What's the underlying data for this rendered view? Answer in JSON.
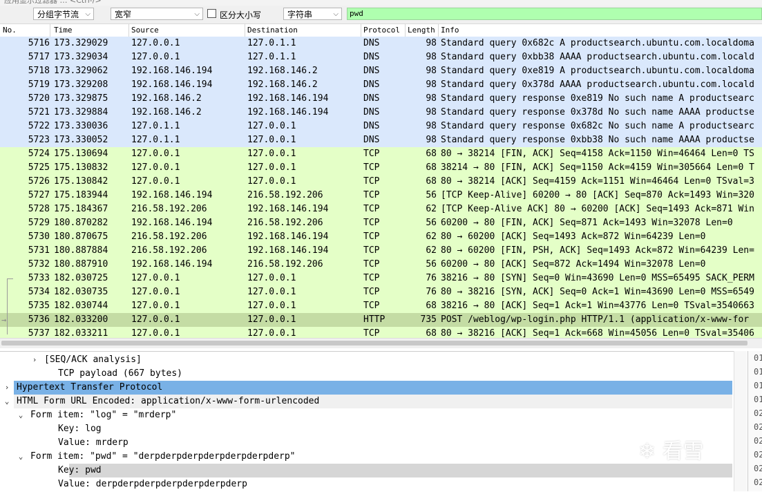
{
  "window_title": "应用显示过滤器 … <Ctrl-/>",
  "toolbar": {
    "group_mode": "分组字节流",
    "width_mode": "宽窄",
    "case_sensitive_label": "区分大小写",
    "search_type": "字符串",
    "search_text": "pwd"
  },
  "columns": [
    "No.",
    "Time",
    "Source",
    "Destination",
    "Protocol",
    "Length",
    "Info"
  ],
  "packets": [
    {
      "no": "5716",
      "time": "173.329029",
      "src": "127.0.0.1",
      "dst": "127.0.1.1",
      "proto": "DNS",
      "len": "98",
      "info": "Standard query 0x682c A productsearch.ubuntu.com.localdoma",
      "color": "#dae8fc"
    },
    {
      "no": "5717",
      "time": "173.329034",
      "src": "127.0.0.1",
      "dst": "127.0.1.1",
      "proto": "DNS",
      "len": "98",
      "info": "Standard query 0xbb38 AAAA productsearch.ubuntu.com.locald",
      "color": "#dae8fc"
    },
    {
      "no": "5718",
      "time": "173.329062",
      "src": "192.168.146.194",
      "dst": "192.168.146.2",
      "proto": "DNS",
      "len": "98",
      "info": "Standard query 0xe819 A productsearch.ubuntu.com.localdoma",
      "color": "#dae8fc"
    },
    {
      "no": "5719",
      "time": "173.329208",
      "src": "192.168.146.194",
      "dst": "192.168.146.2",
      "proto": "DNS",
      "len": "98",
      "info": "Standard query 0x378d AAAA productsearch.ubuntu.com.locald",
      "color": "#dae8fc"
    },
    {
      "no": "5720",
      "time": "173.329875",
      "src": "192.168.146.2",
      "dst": "192.168.146.194",
      "proto": "DNS",
      "len": "98",
      "info": "Standard query response 0xe819 No such name A productsearc",
      "color": "#dae8fc"
    },
    {
      "no": "5721",
      "time": "173.329884",
      "src": "192.168.146.2",
      "dst": "192.168.146.194",
      "proto": "DNS",
      "len": "98",
      "info": "Standard query response 0x378d No such name AAAA productse",
      "color": "#dae8fc"
    },
    {
      "no": "5722",
      "time": "173.330036",
      "src": "127.0.1.1",
      "dst": "127.0.0.1",
      "proto": "DNS",
      "len": "98",
      "info": "Standard query response 0x682c No such name A productsearc",
      "color": "#dae8fc"
    },
    {
      "no": "5723",
      "time": "173.330052",
      "src": "127.0.1.1",
      "dst": "127.0.0.1",
      "proto": "DNS",
      "len": "98",
      "info": "Standard query response 0xbb38 No such name AAAA productse",
      "color": "#dae8fc"
    },
    {
      "no": "5724",
      "time": "175.130694",
      "src": "127.0.0.1",
      "dst": "127.0.0.1",
      "proto": "TCP",
      "len": "68",
      "info": "80 → 38214 [FIN, ACK] Seq=4158 Ack=1150 Win=46464 Len=0 TS",
      "color": "#e4ffc7"
    },
    {
      "no": "5725",
      "time": "175.130832",
      "src": "127.0.0.1",
      "dst": "127.0.0.1",
      "proto": "TCP",
      "len": "68",
      "info": "38214 → 80 [FIN, ACK] Seq=1150 Ack=4159 Win=305664 Len=0 T",
      "color": "#e4ffc7"
    },
    {
      "no": "5726",
      "time": "175.130842",
      "src": "127.0.0.1",
      "dst": "127.0.0.1",
      "proto": "TCP",
      "len": "68",
      "info": "80 → 38214 [ACK] Seq=4159 Ack=1151 Win=46464 Len=0 TSval=3",
      "color": "#e4ffc7"
    },
    {
      "no": "5727",
      "time": "175.183944",
      "src": "192.168.146.194",
      "dst": "216.58.192.206",
      "proto": "TCP",
      "len": "56",
      "info": "[TCP Keep-Alive] 60200 → 80 [ACK] Seq=870 Ack=1493 Win=320",
      "color": "#e4ffc7"
    },
    {
      "no": "5728",
      "time": "175.184367",
      "src": "216.58.192.206",
      "dst": "192.168.146.194",
      "proto": "TCP",
      "len": "62",
      "info": "[TCP Keep-Alive ACK] 80 → 60200 [ACK] Seq=1493 Ack=871 Win",
      "color": "#e4ffc7"
    },
    {
      "no": "5729",
      "time": "180.870282",
      "src": "192.168.146.194",
      "dst": "216.58.192.206",
      "proto": "TCP",
      "len": "56",
      "info": "60200 → 80 [FIN, ACK] Seq=871 Ack=1493 Win=32078 Len=0",
      "color": "#e4ffc7"
    },
    {
      "no": "5730",
      "time": "180.870675",
      "src": "216.58.192.206",
      "dst": "192.168.146.194",
      "proto": "TCP",
      "len": "62",
      "info": "80 → 60200 [ACK] Seq=1493 Ack=872 Win=64239 Len=0",
      "color": "#e4ffc7"
    },
    {
      "no": "5731",
      "time": "180.887884",
      "src": "216.58.192.206",
      "dst": "192.168.146.194",
      "proto": "TCP",
      "len": "62",
      "info": "80 → 60200 [FIN, PSH, ACK] Seq=1493 Ack=872 Win=64239 Len=",
      "color": "#e4ffc7"
    },
    {
      "no": "5732",
      "time": "180.887910",
      "src": "192.168.146.194",
      "dst": "216.58.192.206",
      "proto": "TCP",
      "len": "56",
      "info": "60200 → 80 [ACK] Seq=872 Ack=1494 Win=32078 Len=0",
      "color": "#e4ffc7"
    },
    {
      "no": "5733",
      "time": "182.030725",
      "src": "127.0.0.1",
      "dst": "127.0.0.1",
      "proto": "TCP",
      "len": "76",
      "info": "38216 → 80 [SYN] Seq=0 Win=43690 Len=0 MSS=65495 SACK_PERM",
      "color": "#e4ffc7"
    },
    {
      "no": "5734",
      "time": "182.030735",
      "src": "127.0.0.1",
      "dst": "127.0.0.1",
      "proto": "TCP",
      "len": "76",
      "info": "80 → 38216 [SYN, ACK] Seq=0 Ack=1 Win=43690 Len=0 MSS=6549",
      "color": "#e4ffc7"
    },
    {
      "no": "5735",
      "time": "182.030744",
      "src": "127.0.0.1",
      "dst": "127.0.0.1",
      "proto": "TCP",
      "len": "68",
      "info": "38216 → 80 [ACK] Seq=1 Ack=1 Win=43776 Len=0 TSval=3540663",
      "color": "#e4ffc7"
    },
    {
      "no": "5736",
      "time": "182.033200",
      "src": "127.0.0.1",
      "dst": "127.0.0.1",
      "proto": "HTTP",
      "len": "735",
      "info": "POST /weblog/wp-login.php HTTP/1.1  (application/x-www-for",
      "color": "#c4dca4"
    },
    {
      "no": "5737",
      "time": "182.033211",
      "src": "127.0.0.1",
      "dst": "127.0.0.1",
      "proto": "TCP",
      "len": "68",
      "info": "80 → 38216 [ACK] Seq=1 Ack=668 Win=45056 Len=0 TSval=35406",
      "color": "#e4ffc7"
    }
  ],
  "details": [
    {
      "indent": 2,
      "toggle": "›",
      "text": "[SEQ/ACK analysis]",
      "bg": ""
    },
    {
      "indent": 2,
      "toggle": "",
      "text": "TCP payload (667 bytes)",
      "bg": ""
    },
    {
      "indent": 0,
      "toggle": "›",
      "text": "Hypertext Transfer Protocol",
      "bg": "#79b1e6"
    },
    {
      "indent": 0,
      "toggle": "⌄",
      "text": "HTML Form URL Encoded: application/x-www-form-urlencoded",
      "bg": "#f0f0f0"
    },
    {
      "indent": 1,
      "toggle": "⌄",
      "text": "Form item: \"log\" = \"mrderp\"",
      "bg": ""
    },
    {
      "indent": 2,
      "toggle": "",
      "text": "Key: log",
      "bg": ""
    },
    {
      "indent": 2,
      "toggle": "",
      "text": "Value: mrderp",
      "bg": ""
    },
    {
      "indent": 1,
      "toggle": "⌄",
      "text": "Form item: \"pwd\" = \"derpderpderpderpderpderpderp\"",
      "bg": ""
    },
    {
      "indent": 2,
      "toggle": "",
      "text": "Key: pwd",
      "bg": "#d6d6d6"
    },
    {
      "indent": 2,
      "toggle": "",
      "text": "Value: derpderpderpderpderpderpderp",
      "bg": ""
    }
  ],
  "bytes_column": [
    "01",
    "01",
    "01",
    "01",
    "02",
    "02",
    "02",
    "02",
    "02",
    "02",
    "02"
  ],
  "watermark_text": "看雪"
}
